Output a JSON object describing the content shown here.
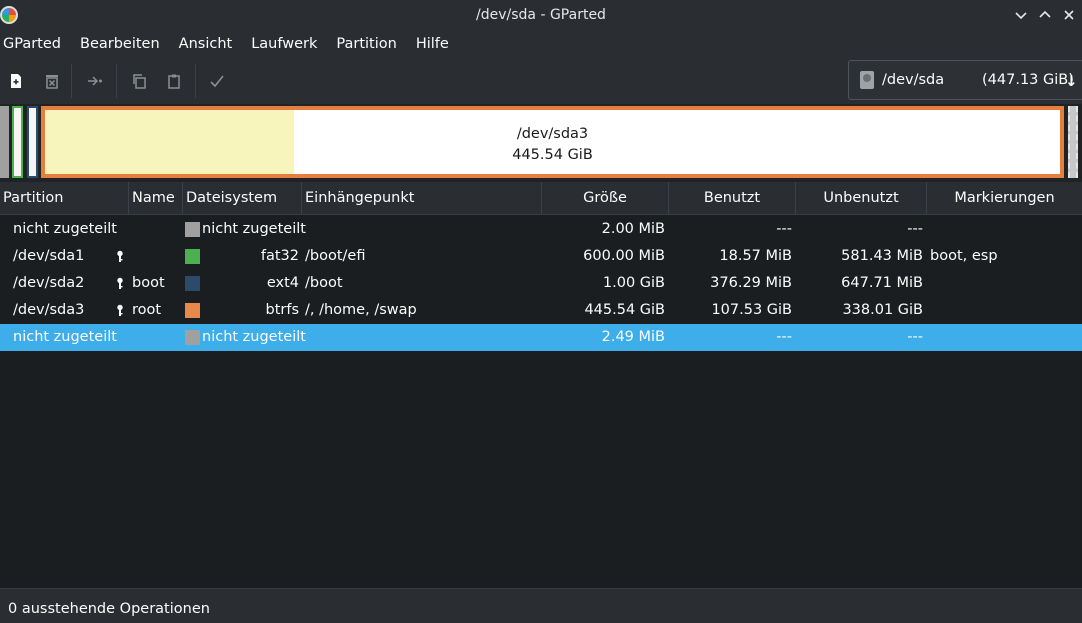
{
  "window": {
    "title": "/dev/sda - GParted"
  },
  "menu": [
    "GParted",
    "Bearbeiten",
    "Ansicht",
    "Laufwerk",
    "Partition",
    "Hilfe"
  ],
  "device": {
    "name": "/dev/sda",
    "size": "(447.13 GiB)"
  },
  "graph": {
    "main_partition": "/dev/sda3",
    "main_size": "445.54 GiB",
    "main_used_fraction": 0.245
  },
  "table": {
    "headers": [
      "Partition",
      "Name",
      "Dateisystem",
      "Einhängepunkt",
      "Größe",
      "Benutzt",
      "Unbenutzt",
      "Markierungen"
    ],
    "rows": [
      {
        "partition": "nicht zugeteilt",
        "locked": false,
        "name": "",
        "fs_color": "#a0a0a0",
        "fs": "nicht zugeteilt",
        "mount": "",
        "size": "2.00 MiB",
        "used": "---",
        "unused": "---",
        "flags": "",
        "selected": false
      },
      {
        "partition": "/dev/sda1",
        "locked": true,
        "name": "",
        "fs_color": "#4caf50",
        "fs": "fat32",
        "mount": "/boot/efi",
        "size": "600.00 MiB",
        "used": "18.57 MiB",
        "unused": "581.43 MiB",
        "flags": "boot, esp",
        "selected": false
      },
      {
        "partition": "/dev/sda2",
        "locked": true,
        "name": "boot",
        "fs_color": "#2e4a6b",
        "fs": "ext4",
        "mount": "/boot",
        "size": "1.00 GiB",
        "used": "376.29 MiB",
        "unused": "647.71 MiB",
        "flags": "",
        "selected": false
      },
      {
        "partition": "/dev/sda3",
        "locked": true,
        "name": "root",
        "fs_color": "#e8894a",
        "fs": "btrfs",
        "mount": "/, /home, /swap",
        "size": "445.54 GiB",
        "used": "107.53 GiB",
        "unused": "338.01 GiB",
        "flags": "",
        "selected": false
      },
      {
        "partition": "nicht zugeteilt",
        "locked": false,
        "name": "",
        "fs_color": "#a0a0a0",
        "fs": "nicht zugeteilt",
        "mount": "",
        "size": "2.49 MiB",
        "used": "---",
        "unused": "---",
        "flags": "",
        "selected": true
      }
    ]
  },
  "status": {
    "text": "0 ausstehende Operationen"
  },
  "icons": {
    "toolbar": [
      "new-partition-icon",
      "delete-partition-icon",
      "resize-move-icon",
      "copy-icon",
      "paste-icon",
      "apply-icon"
    ],
    "window": [
      "minimize-icon",
      "maximize-icon",
      "close-icon"
    ]
  }
}
